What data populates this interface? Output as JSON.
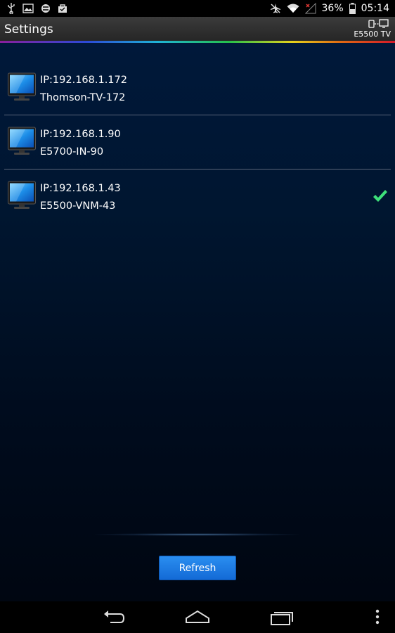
{
  "status_bar": {
    "battery_percent": "36%",
    "time": "05:14",
    "icons": [
      "usb-icon",
      "image-icon",
      "media-icon",
      "bag-icon",
      "airplane-off-icon",
      "wifi-icon",
      "signal-icon",
      "battery-icon"
    ]
  },
  "action_bar": {
    "title": "Settings",
    "connected_device": "E5500 TV"
  },
  "devices": [
    {
      "ip": "IP:192.168.1.172",
      "name": "Thomson-TV-172",
      "selected": false
    },
    {
      "ip": "IP:192.168.1.90",
      "name": "E5700-IN-90",
      "selected": false
    },
    {
      "ip": "IP:192.168.1.43",
      "name": "E5500-VNM-43",
      "selected": true
    }
  ],
  "refresh_label": "Refresh",
  "colors": {
    "accent_blue": "#1e7fe6",
    "check_green": "#3ee07a",
    "background_top": "#00183a"
  },
  "nav_bar": {
    "icons": [
      "back-icon",
      "home-icon",
      "recent-apps-icon",
      "overflow-menu-icon"
    ]
  }
}
